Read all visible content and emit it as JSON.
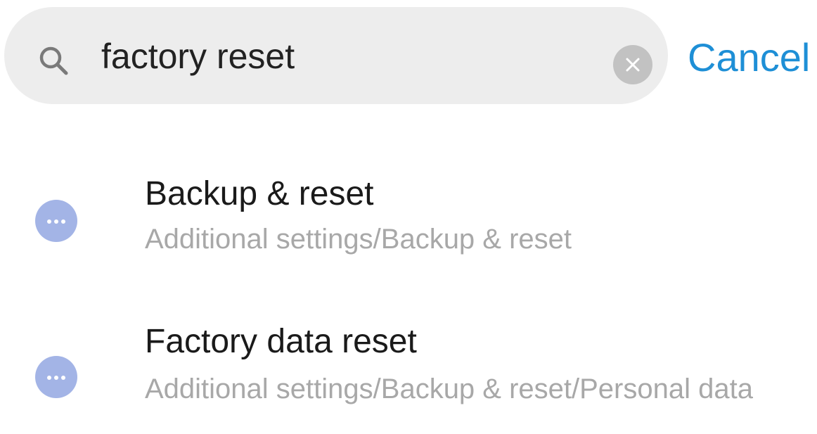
{
  "search": {
    "value": "factory reset",
    "icon": "search-icon",
    "clear_icon": "close-icon",
    "cancel_label": "Cancel"
  },
  "colors": {
    "search_background": "#ededed",
    "accent": "#1e8fd6",
    "result_icon": "#a3b4e6",
    "path_text": "#a8a8a8",
    "title_text": "#1a1a1a"
  },
  "results": [
    {
      "icon": "more-dots-icon",
      "title": "Backup & reset",
      "path": "Additional settings/Backup & reset"
    },
    {
      "icon": "more-dots-icon",
      "title": "Factory data reset",
      "path": "Additional settings/Backup & reset/Personal data"
    }
  ]
}
